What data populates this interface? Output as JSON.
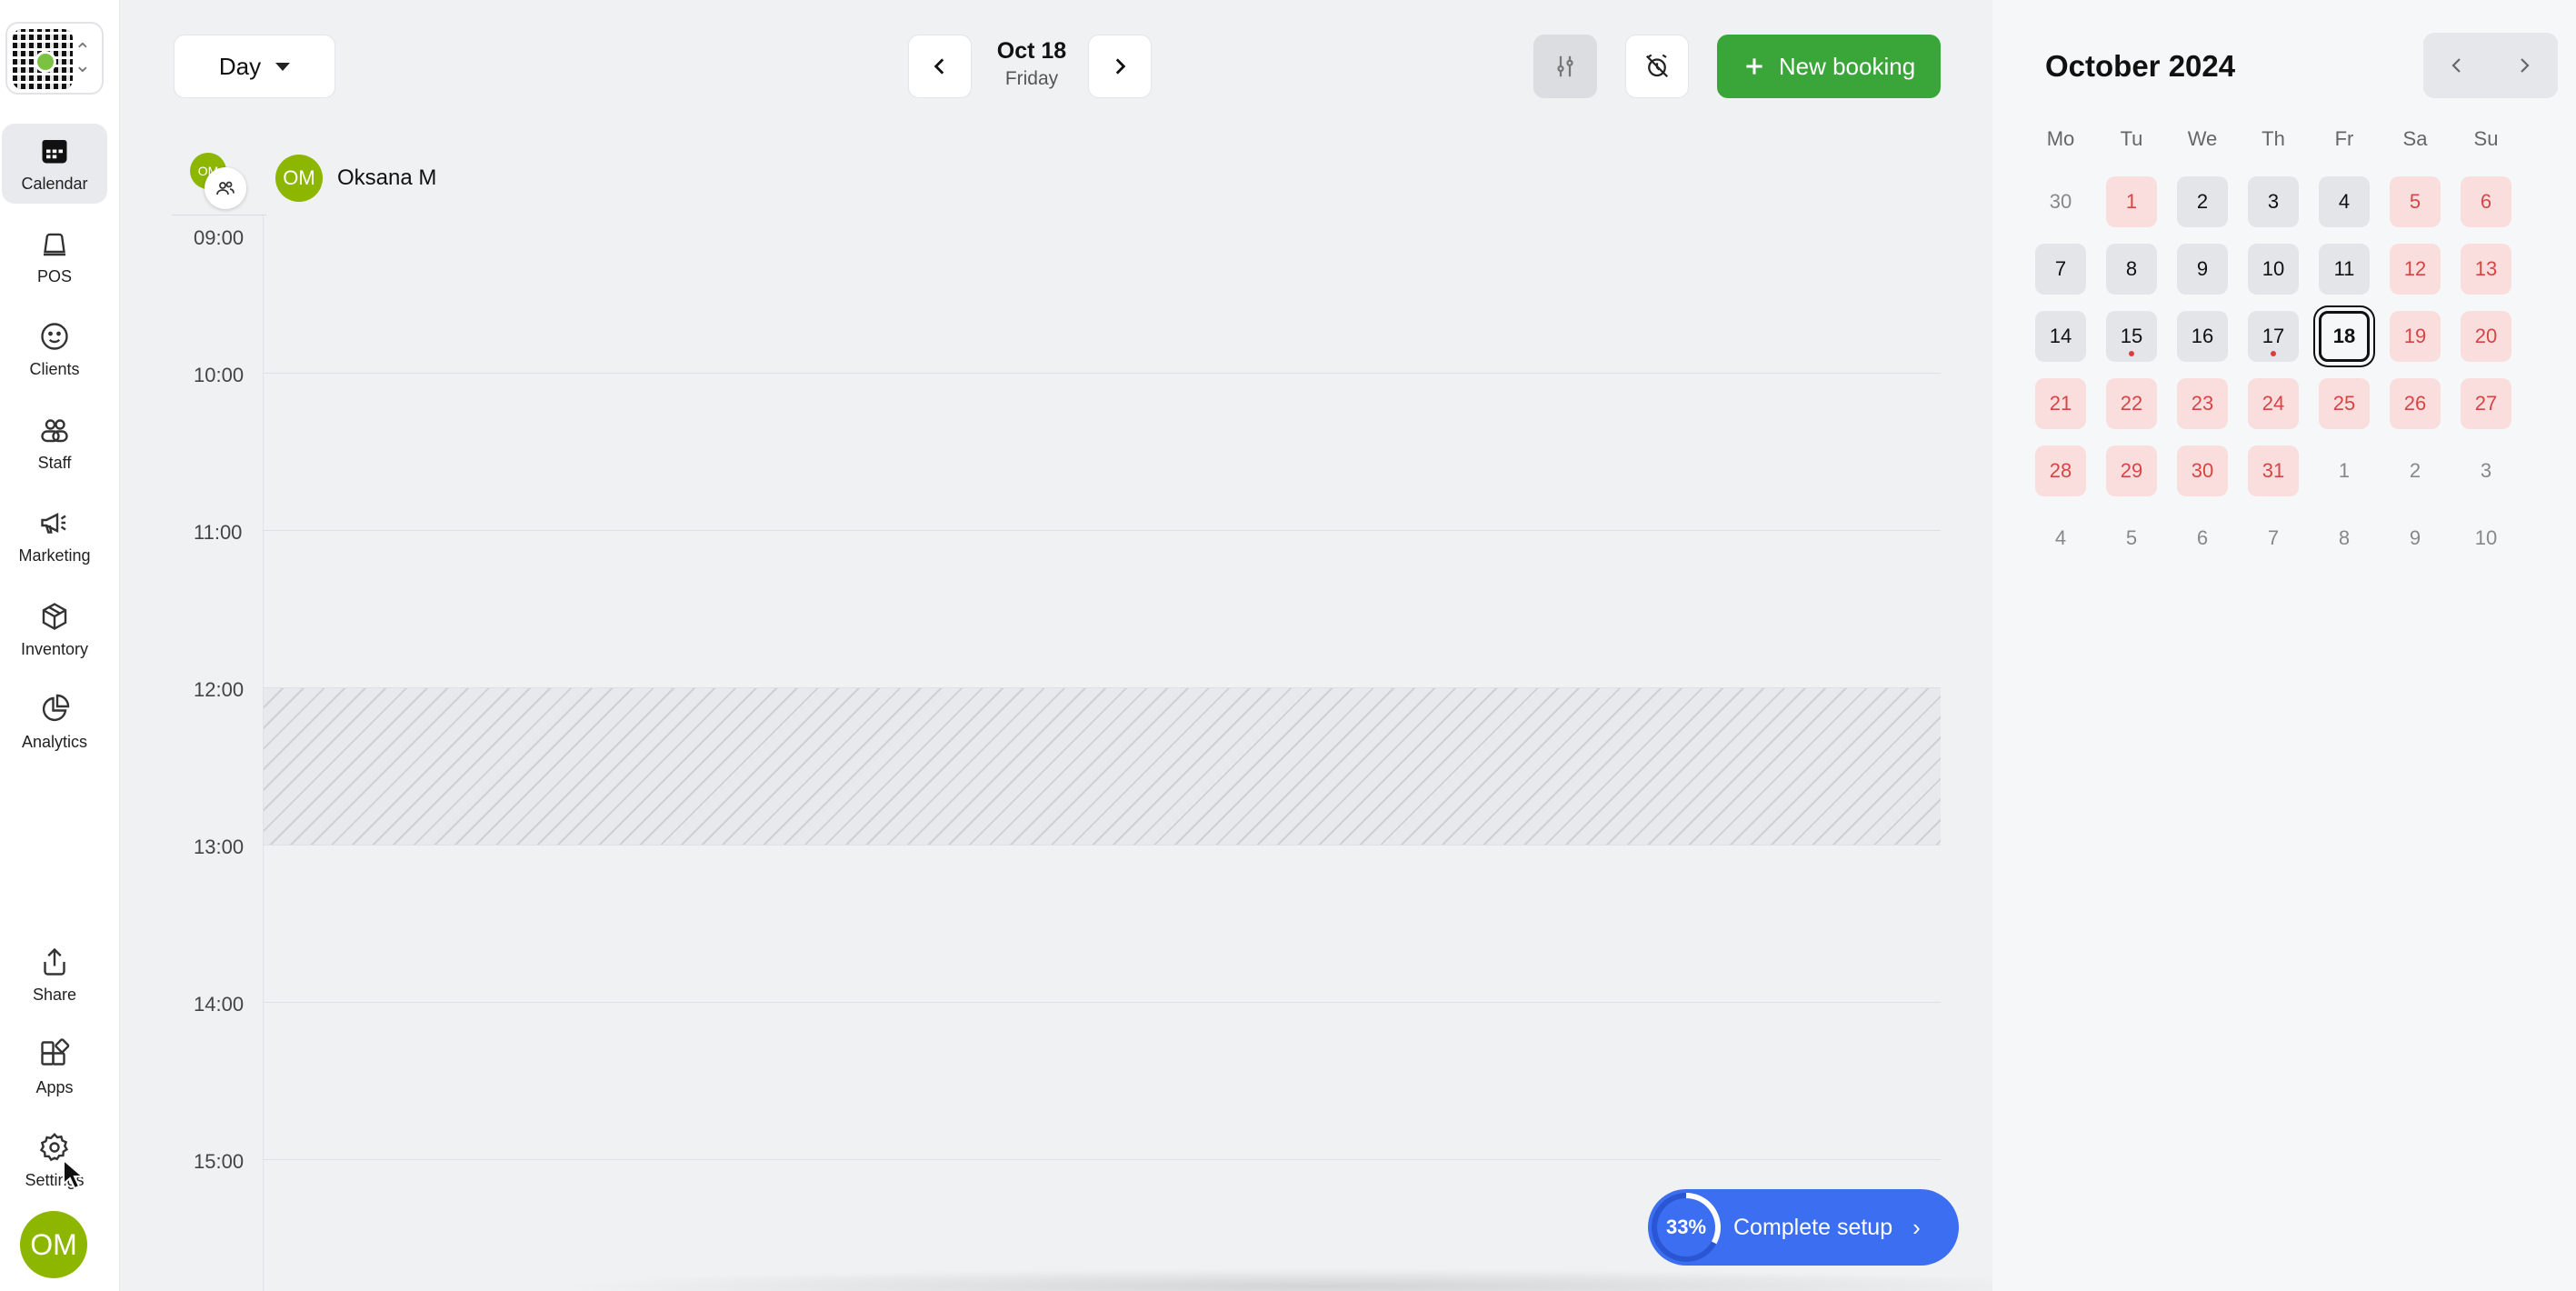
{
  "sidebar": {
    "items": [
      {
        "label": "Calendar",
        "icon": "calendar-icon",
        "active": true
      },
      {
        "label": "POS",
        "icon": "pos-icon"
      },
      {
        "label": "Clients",
        "icon": "smiley-icon"
      },
      {
        "label": "Staff",
        "icon": "staff-icon"
      },
      {
        "label": "Marketing",
        "icon": "megaphone-icon"
      },
      {
        "label": "Inventory",
        "icon": "box-icon"
      },
      {
        "label": "Analytics",
        "icon": "pie-chart-icon"
      }
    ],
    "bottom_items": [
      {
        "label": "Share",
        "icon": "share-icon"
      },
      {
        "label": "Apps",
        "icon": "apps-icon"
      },
      {
        "label": "Settings",
        "icon": "gear-icon"
      }
    ],
    "user_initials": "OM"
  },
  "toolbar": {
    "view_label": "Day",
    "date_label": "Oct 18",
    "weekday_label": "Friday",
    "new_booking_label": "New booking"
  },
  "staff": {
    "group_initials": "OM",
    "member_initials": "OM",
    "member_name": "Oksana M"
  },
  "hours": [
    "09:00",
    "10:00",
    "11:00",
    "12:00",
    "13:00",
    "14:00",
    "15:00"
  ],
  "setup": {
    "percent": "33%",
    "label": "Complete setup",
    "progress_fraction": 0.33
  },
  "mini_calendar": {
    "month_label": "October 2024",
    "weekdays": [
      "Mo",
      "Tu",
      "We",
      "Th",
      "Fr",
      "Sa",
      "Su"
    ],
    "weeks": [
      [
        {
          "d": "30",
          "s": "out"
        },
        {
          "d": "1",
          "s": "red"
        },
        {
          "d": "2",
          "s": "norm"
        },
        {
          "d": "3",
          "s": "norm"
        },
        {
          "d": "4",
          "s": "norm"
        },
        {
          "d": "5",
          "s": "red"
        },
        {
          "d": "6",
          "s": "red"
        }
      ],
      [
        {
          "d": "7",
          "s": "norm"
        },
        {
          "d": "8",
          "s": "norm"
        },
        {
          "d": "9",
          "s": "norm"
        },
        {
          "d": "10",
          "s": "norm"
        },
        {
          "d": "11",
          "s": "norm"
        },
        {
          "d": "12",
          "s": "red"
        },
        {
          "d": "13",
          "s": "red"
        }
      ],
      [
        {
          "d": "14",
          "s": "norm"
        },
        {
          "d": "15",
          "s": "norm",
          "dot": true
        },
        {
          "d": "16",
          "s": "norm"
        },
        {
          "d": "17",
          "s": "norm",
          "dot": true
        },
        {
          "d": "18",
          "s": "sel"
        },
        {
          "d": "19",
          "s": "red"
        },
        {
          "d": "20",
          "s": "red"
        }
      ],
      [
        {
          "d": "21",
          "s": "red"
        },
        {
          "d": "22",
          "s": "red"
        },
        {
          "d": "23",
          "s": "red"
        },
        {
          "d": "24",
          "s": "red"
        },
        {
          "d": "25",
          "s": "red"
        },
        {
          "d": "26",
          "s": "red"
        },
        {
          "d": "27",
          "s": "red"
        }
      ],
      [
        {
          "d": "28",
          "s": "red"
        },
        {
          "d": "29",
          "s": "red"
        },
        {
          "d": "30",
          "s": "red"
        },
        {
          "d": "31",
          "s": "red"
        },
        {
          "d": "1",
          "s": "out"
        },
        {
          "d": "2",
          "s": "out"
        },
        {
          "d": "3",
          "s": "out"
        }
      ],
      [
        {
          "d": "4",
          "s": "out"
        },
        {
          "d": "5",
          "s": "out"
        },
        {
          "d": "6",
          "s": "out"
        },
        {
          "d": "7",
          "s": "out"
        },
        {
          "d": "8",
          "s": "out"
        },
        {
          "d": "9",
          "s": "out"
        },
        {
          "d": "10",
          "s": "out"
        }
      ]
    ]
  },
  "colors": {
    "accent_green": "#3aa63a",
    "accent_blue": "#3b6ef1",
    "avatar_green": "#8db600",
    "weekend_red": "#d64545"
  }
}
